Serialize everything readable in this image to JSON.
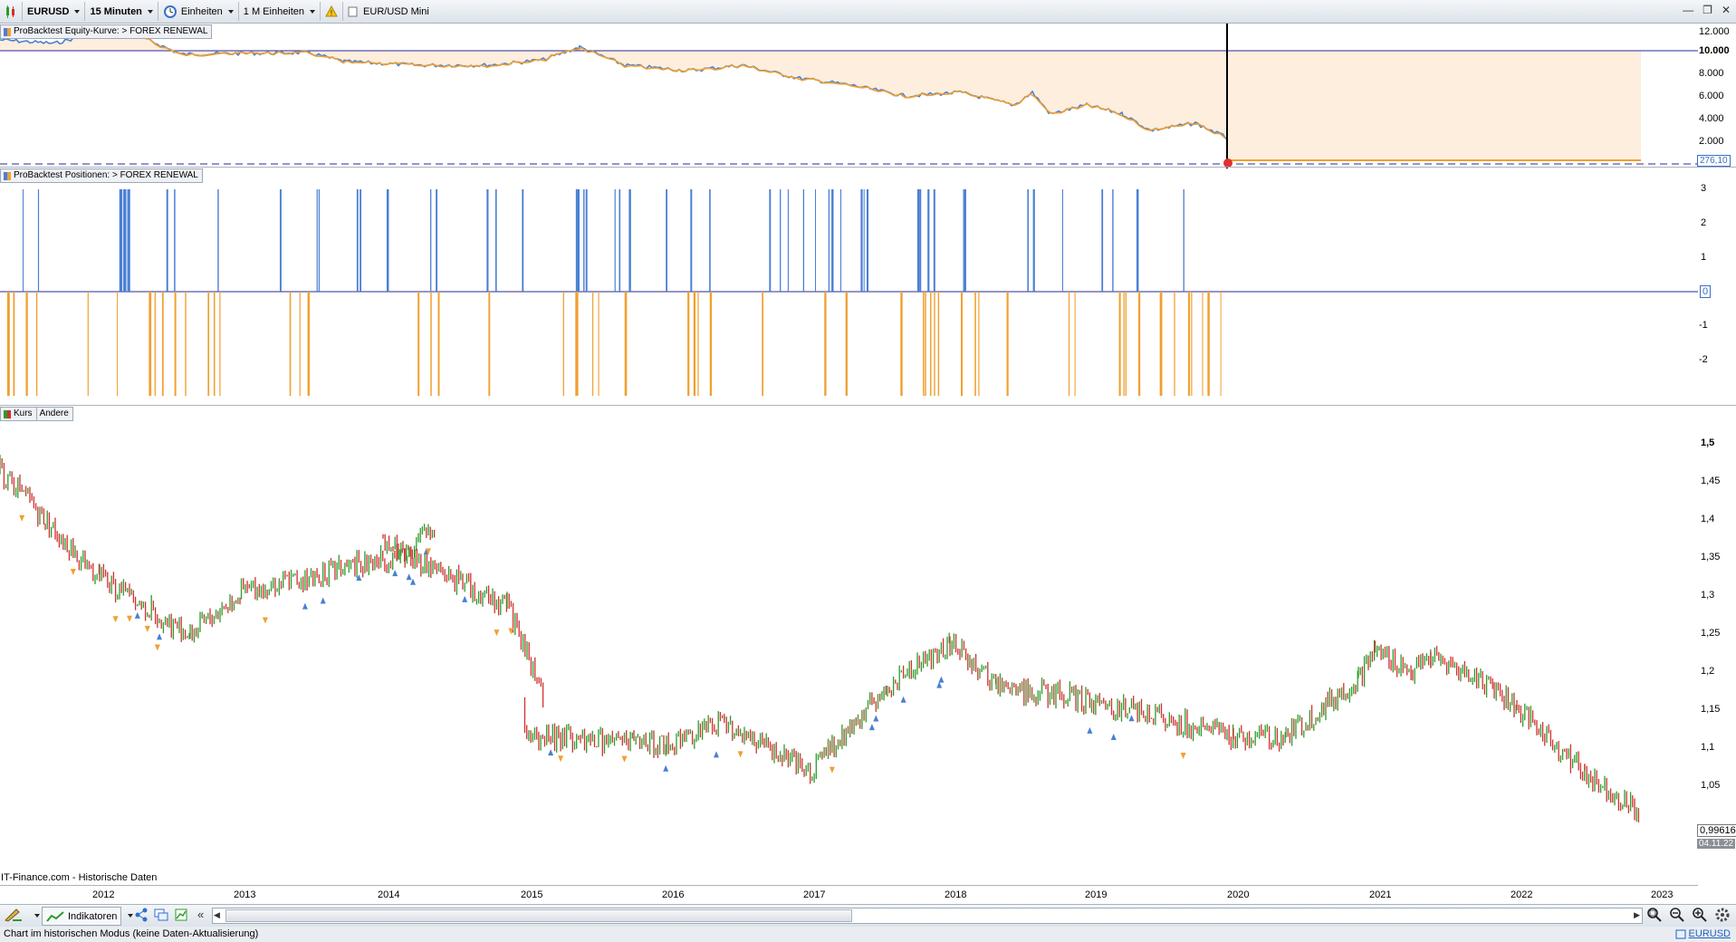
{
  "toolbar": {
    "instrument": "EURUSD",
    "timeframe": "15 Minuten",
    "units_mode": "Einheiten",
    "units_count": "1 M Einheiten",
    "instrument_name": "EUR/USD Mini"
  },
  "panels": {
    "equity_label": "ProBacktest Equity-Kurve: > FOREX RENEWAL",
    "positions_label": "ProBacktest Positionen: > FOREX RENEWAL",
    "price_label_1": "Kurs",
    "price_label_2": "Andere"
  },
  "equity_axis": [
    "12.000",
    "10.000",
    "8.000",
    "6.000",
    "4.000",
    "2.000"
  ],
  "equity_current": "276,10",
  "positions_axis": [
    "3",
    "2",
    "1",
    "0",
    "-1",
    "-2"
  ],
  "price_axis": [
    "1,5",
    "1,45",
    "1,4",
    "1,35",
    "1,3",
    "1,25",
    "1,2",
    "1,15",
    "1,1",
    "1,05"
  ],
  "price_current": "0,99616",
  "price_date": "04.11.22",
  "source_note": "IT-Finance.com - Historische Daten",
  "years": [
    "2012",
    "2013",
    "2014",
    "2015",
    "2016",
    "2017",
    "2018",
    "2019",
    "2020",
    "2021",
    "2022",
    "2023"
  ],
  "bottom": {
    "indicators_label": "Indikatoren",
    "symbol_link": "EURUSD"
  },
  "status": "Chart im historischen Modus (keine Daten-Aktualisierung)",
  "colors": {
    "equity_line": "#4a7fd4",
    "equity_drawdown": "#f0a030",
    "equity_fill": "#fdeedd",
    "long": "#4a7fd4",
    "short": "#f0a030",
    "up_candle": "#2a9d2a",
    "down_candle": "#d03030"
  },
  "chart_data": {
    "type": "line",
    "title": "EURUSD",
    "x": [
      "2012",
      "2013",
      "2014",
      "2015",
      "2016",
      "2017",
      "2018",
      "2019",
      "2020",
      "2021",
      "2022",
      "2023"
    ],
    "series": [
      {
        "name": "Kurs",
        "values": [
          1.32,
          1.3,
          1.37,
          1.13,
          1.09,
          1.06,
          1.23,
          1.15,
          1.11,
          1.22,
          1.14,
          0.99616
        ]
      },
      {
        "name": "Equity",
        "values": [
          11200,
          9000,
          8000,
          7600,
          7200,
          6000,
          4300,
          3000,
          300,
          null,
          null,
          null
        ]
      }
    ],
    "ylim_price": [
      0.95,
      1.52
    ],
    "ylim_equity": [
      0,
      12000
    ]
  }
}
